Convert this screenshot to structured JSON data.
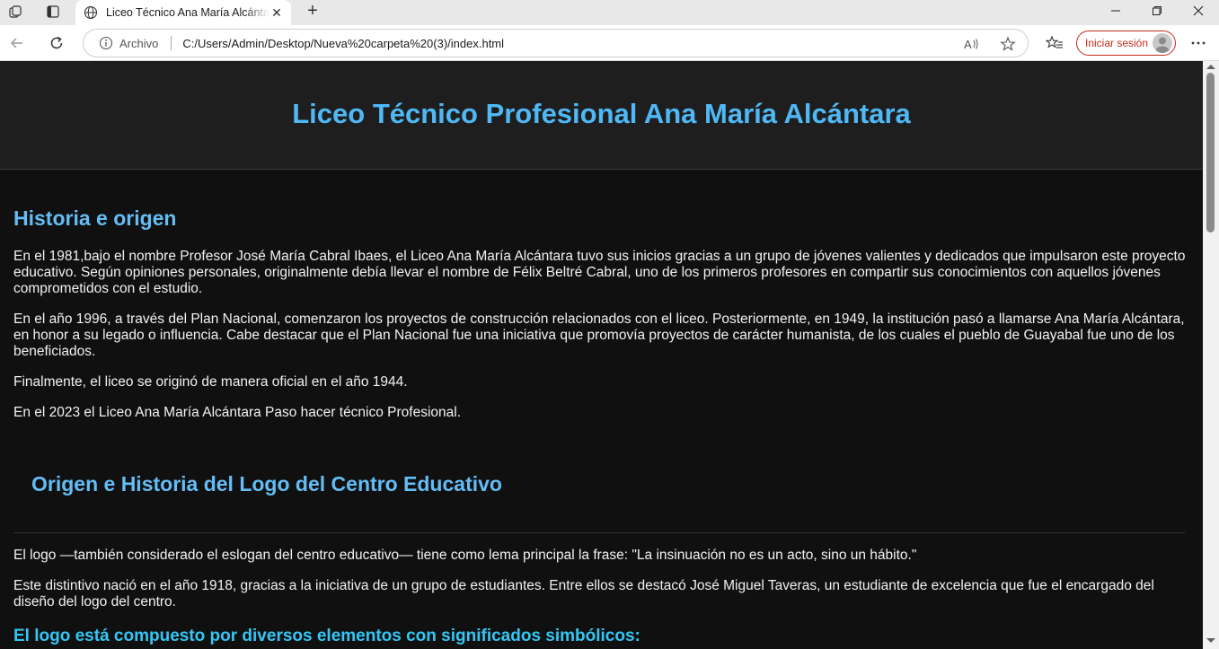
{
  "browser": {
    "tab_title": "Liceo Técnico Ana María Alcántara",
    "new_tab_symbol": "+",
    "address_label": "Archivo",
    "url": "C:/Users/Admin/Desktop/Nueva%20carpeta%20(3)/index.html",
    "signin_label": "Iniciar sesión",
    "icons": [
      "workspaces-icon",
      "tab-actions-icon",
      "globe-icon",
      "close-icon",
      "new-tab-icon",
      "minimize-icon",
      "maximize-icon",
      "window-close-icon",
      "back-icon",
      "refresh-icon",
      "info-icon",
      "read-aloud-icon",
      "favorite-star-icon",
      "favorites-icon",
      "profile-icon",
      "more-icon"
    ],
    "accent_color": "#c42b1c"
  },
  "page": {
    "title": "Liceo Técnico Profesional Ana María Alcántara",
    "history": {
      "heading": "Historia e origen",
      "paragraphs": [
        "En el 1981,bajo el nombre Profesor José María Cabral Ibaes, el Liceo Ana María Alcántara tuvo sus inicios gracias a un grupo de jóvenes valientes y dedicados que impulsaron este proyecto educativo. Según opiniones personales, originalmente debía llevar el nombre de Félix Beltré Cabral, uno de los primeros profesores en compartir sus conocimientos con aquellos jóvenes comprometidos con el estudio.",
        "En el año 1996, a través del Plan Nacional, comenzaron los proyectos de construcción relacionados con el liceo. Posteriormente, en 1949, la institución pasó a llamarse Ana María Alcántara, en honor a su legado o influencia. Cabe destacar que el Plan Nacional fue una iniciativa que promovía proyectos de carácter humanista, de los cuales el pueblo de Guayabal fue uno de los beneficiados.",
        "Finalmente, el liceo se originó de manera oficial en el año 1944.",
        "En el 2023 el Liceo Ana María Alcántara Paso hacer técnico Profesional."
      ]
    },
    "logo": {
      "heading": "Origen e Historia del Logo del Centro Educativo",
      "paragraphs": [
        "El logo —también considerado el eslogan del centro educativo— tiene como lema principal la frase: \"La insinuación no es un acto, sino un hábito.\"",
        "Este distintivo nació en el año 1918, gracias a la iniciativa de un grupo de estudiantes. Entre ellos se destacó José Miguel Taveras, un estudiante de excelencia que fue el encargado del diseño del logo del centro."
      ],
      "subheading": "El logo está compuesto por diversos elementos con significados simbólicos:"
    },
    "colors": {
      "background": "#101010",
      "header_bg": "#1e1e1e",
      "title": "#4fb8f5",
      "heading": "#64bdf5",
      "subheading": "#34c6f5",
      "text": "#f2f2f2"
    }
  }
}
